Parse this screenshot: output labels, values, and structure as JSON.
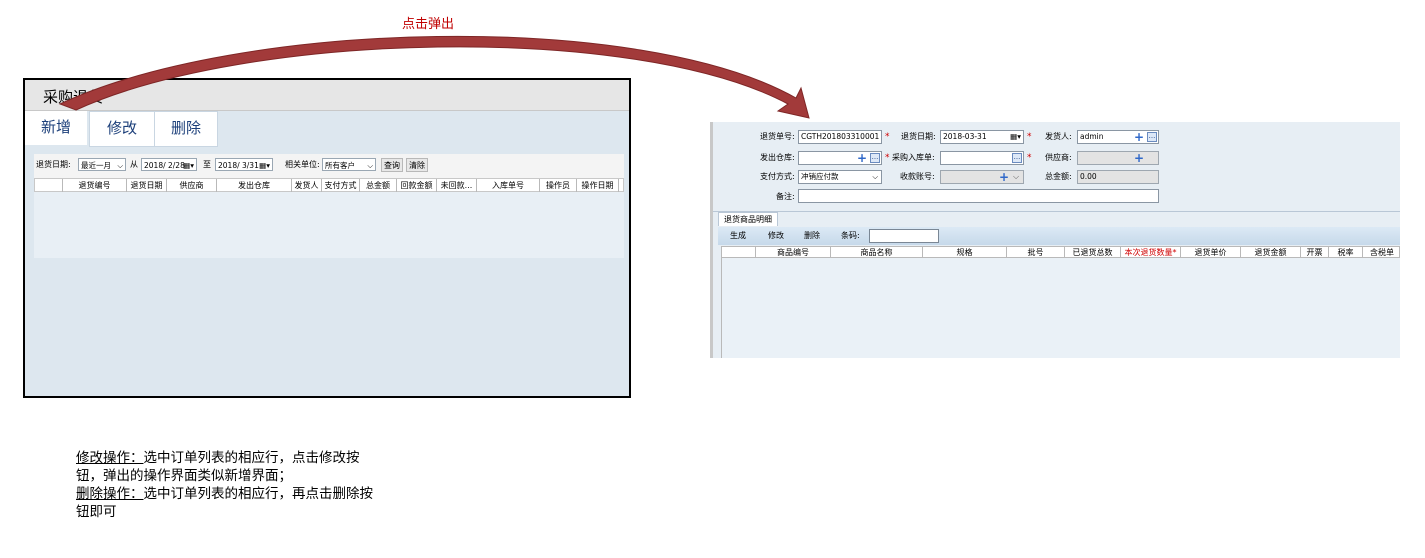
{
  "annotation": {
    "arrow_label": "点击弹出"
  },
  "left_window": {
    "title": "采购退货",
    "tabs": [
      "新增",
      "修改",
      "删除"
    ],
    "filter": {
      "date_label": "退货日期:",
      "range_value": "最近一月",
      "from_label": "从",
      "start_date": "2018/ 2/28",
      "to_label": "至",
      "end_date": "2018/ 3/31",
      "unit_label": "相关单位:",
      "unit_value": "所有客户",
      "query_button": "查询",
      "clear_button": "清除"
    },
    "columns": [
      "退货编号",
      "退货日期",
      "供应商",
      "发出仓库",
      "发货人",
      "支付方式",
      "总金额",
      "回款金额",
      "未回款...",
      "入库单号",
      "操作员",
      "操作日期"
    ]
  },
  "dialog": {
    "return_no_label": "退货单号:",
    "return_no": "CGTH201803310001",
    "return_date_label": "退货日期:",
    "return_date": "2018-03-31",
    "shipper_label": "发货人:",
    "shipper": "admin",
    "warehouse_label": "发出仓库:",
    "warehouse": "",
    "purchase_in_label": "采购入库单:",
    "purchase_in": "",
    "supplier_label": "供应商:",
    "supplier": "",
    "payment_label": "支付方式:",
    "payment": "冲销应付款",
    "account_label": "收款账号:",
    "account": "",
    "total_label": "总金额:",
    "total": "0.00",
    "remark_label": "备注:",
    "remark": "",
    "detail_tab": "退货商品明细",
    "toolbar": {
      "generate": "生成",
      "edit": "修改",
      "delete": "删除",
      "barcode_label": "条码:"
    },
    "detail_columns": [
      "商品编号",
      "商品名称",
      "规格",
      "批号",
      "已退货总数",
      "本次退货数量*",
      "退货单价",
      "退货金额",
      "开票",
      "税率",
      "含税单"
    ]
  },
  "note": {
    "edit_title": "修改操作：",
    "edit_text1": "选中订单列表的相应行，点击修改按",
    "edit_text2": "钮，弹出的操作界面类似新增界面；",
    "delete_title": "删除操作：",
    "delete_text1": "选中订单列表的相应行，再点击删除按",
    "delete_text2": "钮即可"
  },
  "colors": {
    "arrow": "#a23a3a",
    "label_red": "#c00000",
    "tab_text": "#1c3f7a"
  }
}
